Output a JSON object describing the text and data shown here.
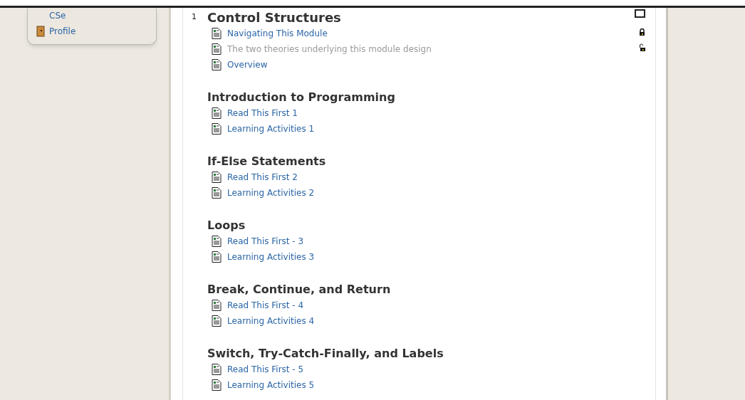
{
  "sidebar": {
    "items": [
      {
        "label": "CSe",
        "kind": "link"
      },
      {
        "label": "Profile",
        "kind": "profile"
      }
    ]
  },
  "sections": [
    {
      "number": "1",
      "title": "Control Structures",
      "checked": false,
      "items": [
        {
          "label": "Navigating This Module",
          "dimmed": false,
          "locked": true
        },
        {
          "label": "The two theories underlying this module design",
          "dimmed": true,
          "locked": false
        },
        {
          "label": "Overview",
          "dimmed": false
        }
      ]
    },
    {
      "title": "Introduction to Programming",
      "items": [
        {
          "label": "Read This First 1",
          "dimmed": false
        },
        {
          "label": "Learning Activities 1",
          "dimmed": false
        }
      ]
    },
    {
      "title": "If-Else Statements",
      "items": [
        {
          "label": "Read This First 2",
          "dimmed": false
        },
        {
          "label": "Learning Activities 2",
          "dimmed": false
        }
      ]
    },
    {
      "title": "Loops",
      "items": [
        {
          "label": "Read This First - 3",
          "dimmed": false
        },
        {
          "label": "Learning Activities 3",
          "dimmed": false
        }
      ]
    },
    {
      "title": "Break, Continue, and Return",
      "items": [
        {
          "label": "Read This First - 4",
          "dimmed": false
        },
        {
          "label": "Learning Activities 4",
          "dimmed": false
        }
      ]
    },
    {
      "title": "Switch, Try-Catch-Finally, and Labels",
      "items": [
        {
          "label": "Read This First - 5",
          "dimmed": false
        },
        {
          "label": "Learning Activities 5",
          "dimmed": false
        }
      ]
    }
  ]
}
